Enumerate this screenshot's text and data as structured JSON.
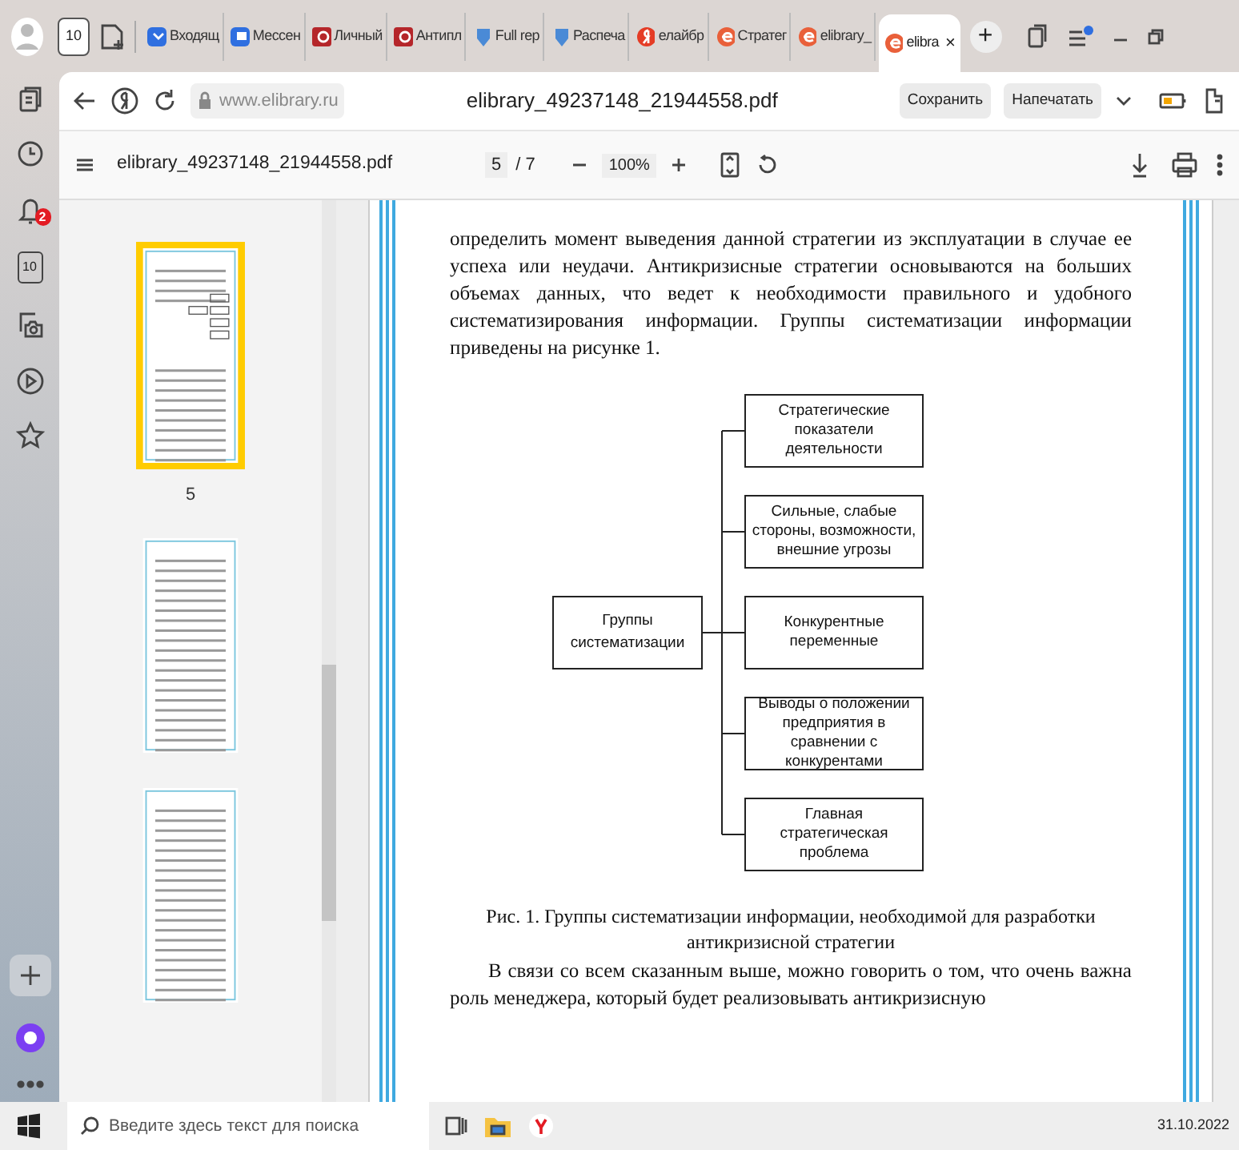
{
  "browser_tabs": [
    {
      "label": "Входящ",
      "kind": "mail",
      "selected": false
    },
    {
      "label": "Мессен",
      "kind": "chat",
      "selected": false
    },
    {
      "label": "Личный",
      "kind": "shield-red",
      "selected": false
    },
    {
      "label": "Антипл",
      "kind": "shield-red",
      "selected": false
    },
    {
      "label": "Full rep",
      "kind": "shield-blue",
      "selected": false
    },
    {
      "label": "Распеча",
      "kind": "shield-blue",
      "selected": false
    },
    {
      "label": "елайбр",
      "kind": "yandex",
      "selected": false
    },
    {
      "label": "Стратег",
      "kind": "e",
      "selected": false
    },
    {
      "label": "elibrary_",
      "kind": "e",
      "selected": false
    },
    {
      "label": "elibra",
      "kind": "e",
      "selected": true
    }
  ],
  "tab_bar": {
    "counter": "10",
    "close": "×",
    "new_tab": "+"
  },
  "sidebar": {
    "notification_count": "2",
    "counter": "10"
  },
  "address_bar": {
    "url": "www.elibrary.ru",
    "title": "elibrary_49237148_21944558.pdf",
    "buttons": [
      "Сохранить",
      "Напечатать"
    ]
  },
  "pdf_toolbar": {
    "filename": "elibrary_49237148_21944558.pdf",
    "page": "5",
    "page_total": "/ 7",
    "zoom": "100%"
  },
  "thumbnails": [
    {
      "label": "5",
      "selected": true
    },
    {
      "selected": false
    },
    {
      "selected": false
    }
  ],
  "document": {
    "paragraph": "определить момент выведения данной стратегии из эксплуатации в случае ее успеха или неудачи. Антикризисные стратегии основываются на больших объемах данных, что ведет к необходимости правильного и удобного систематизирования информации. Группы систематизации информации приведены на рисунке 1.",
    "diagram": {
      "root": "Группы систематизации",
      "branches": [
        "Стратегические показатели деятельности",
        "Сильные, слабые стороны, возможности, внешние угрозы",
        "Конкурентные переменные",
        "Выводы о положении предприятия в сравнении с конкурентами",
        "Главная стратегическая проблема"
      ]
    },
    "caption": "Рис. 1. Группы систематизации информации, необходимой для разработки антикризисной стратегии",
    "paragraph_2": "В связи со всем сказанным выше, можно говорить о том, что очень важна роль менеджера, который будет реализовывать антикризисную"
  },
  "taskbar": {
    "search_placeholder": "Введите здесь текст для поиска",
    "date": "31.10.2022"
  }
}
